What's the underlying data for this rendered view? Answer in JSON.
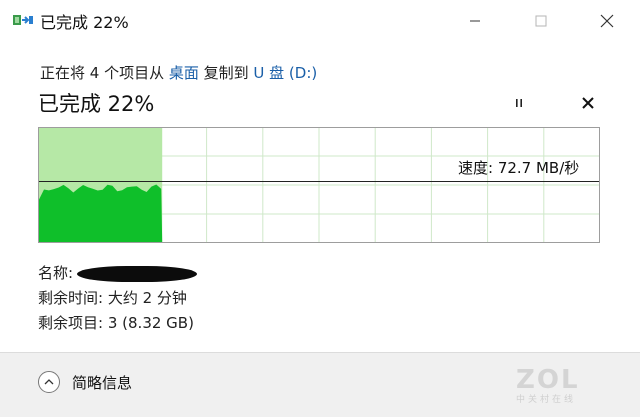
{
  "window": {
    "title": "已完成 22%",
    "icon": "copy-file-icon"
  },
  "copy": {
    "prefix": "正在将 4 个项目从 ",
    "source": "桌面",
    "middle": " 复制到 ",
    "destination": "U 盘 (D:)"
  },
  "progress": {
    "title": "已完成 22%",
    "percent": 22
  },
  "graph": {
    "speed_label": "速度: 72.7 MB/秒",
    "completed_fraction": 0.22,
    "speed_line_fraction": 0.47,
    "colors": {
      "completed": "#b6e8a6",
      "speed": "#0fbf2a",
      "grid": "#cfe8c9",
      "border": "#9d9d9d",
      "line": "#222222"
    }
  },
  "details": {
    "name_label": "名称:",
    "time_label": "剩余时间:",
    "time_value": "大约 2 分钟",
    "items_label": "剩余项目:",
    "items_value": "3 (8.32 GB)"
  },
  "footer": {
    "less_label": "简略信息"
  },
  "watermark": {
    "big": "ZOL",
    "small": "中关村在线"
  }
}
